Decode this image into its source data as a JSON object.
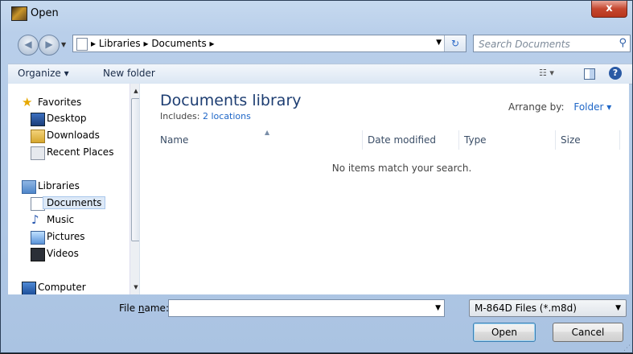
{
  "window": {
    "title": "Open",
    "close_glyph": "x"
  },
  "nav": {
    "back_icon": "back-arrow-icon",
    "forward_icon": "forward-arrow-icon",
    "breadcrumbs": "▸ Libraries ▸ Documents ▸",
    "search_placeholder": "Search Documents"
  },
  "toolbar": {
    "organize": "Organize ▾",
    "new_folder": "New folder",
    "help": "?"
  },
  "sidebar": {
    "favorites": "Favorites",
    "desktop": "Desktop",
    "downloads": "Downloads",
    "recent": "Recent Places",
    "libraries": "Libraries",
    "documents": "Documents",
    "music": "Music",
    "pictures": "Pictures",
    "videos": "Videos",
    "computer": "Computer"
  },
  "library": {
    "title": "Documents library",
    "includes_label": "Includes:",
    "includes_link": "2 locations",
    "arrange_label": "Arrange by:",
    "arrange_value": "Folder ▾"
  },
  "columns": {
    "name": "Name",
    "date": "Date modified",
    "type": "Type",
    "size": "Size"
  },
  "empty_message": "No items match your search.",
  "footer": {
    "file_name_prefix": "File ",
    "file_name_mnemonic": "n",
    "file_name_suffix": "ame:",
    "file_name_value": "",
    "file_type": "M-864D Files (*.m8d)",
    "open": "Open",
    "cancel": "Cancel"
  },
  "colors": {
    "accent": "#1e66c7",
    "title_text": "#1e3e72",
    "close_red": "#c5472f"
  }
}
